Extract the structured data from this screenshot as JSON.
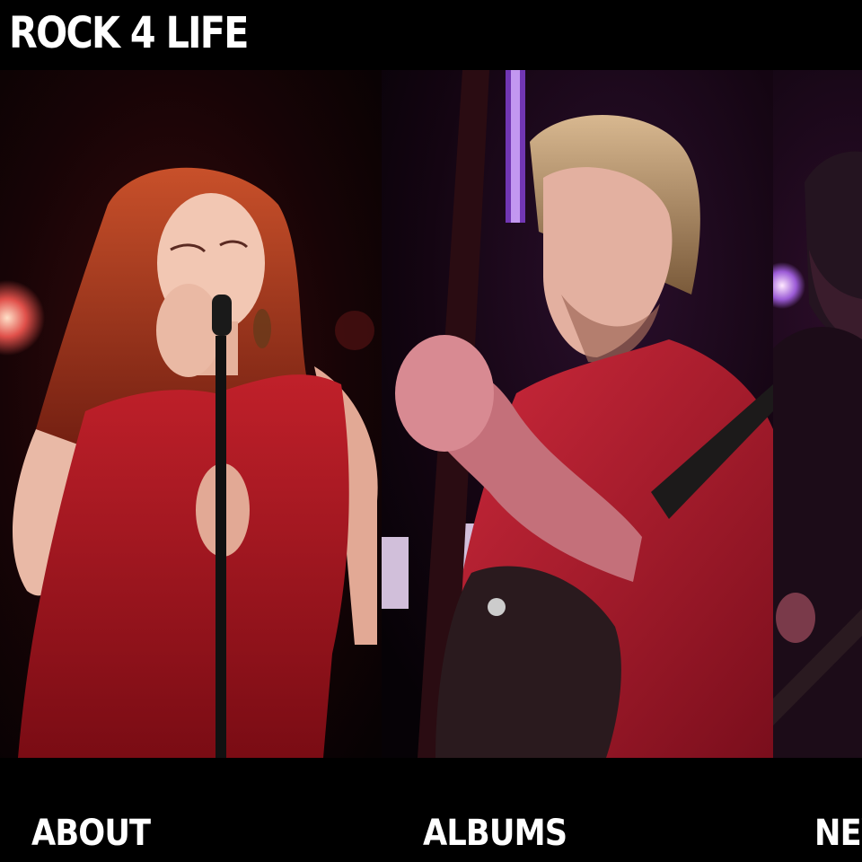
{
  "header": {
    "logo": "ROCK 4 LIFE"
  },
  "panels": [
    {
      "label": "ABOUT",
      "photo": "singer-with-microphone"
    },
    {
      "label": "ALBUMS",
      "photo": "guitarist-on-stage"
    },
    {
      "label": "NEWS",
      "photo": "bassist-on-stage"
    }
  ],
  "colors": {
    "background": "#000000",
    "text": "#ffffff",
    "stage_red": "#b3121c",
    "stage_purple": "#7b3cc4"
  }
}
